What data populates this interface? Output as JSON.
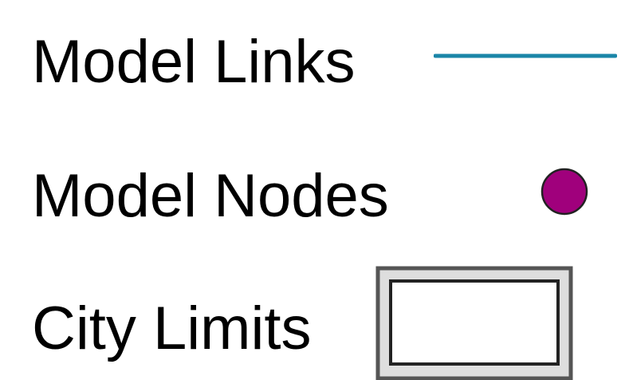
{
  "legend": {
    "items": [
      {
        "label": "Model Links",
        "symbol": "line",
        "color": "#1a86a8"
      },
      {
        "label": "Model Nodes",
        "symbol": "circle",
        "color": "#a0007c",
        "stroke": "#222222"
      },
      {
        "label": "City Limits",
        "symbol": "rectangle-outline",
        "outer_stroke": "#555555",
        "fill": "#dedede",
        "inner_stroke": "#222222"
      }
    ]
  }
}
